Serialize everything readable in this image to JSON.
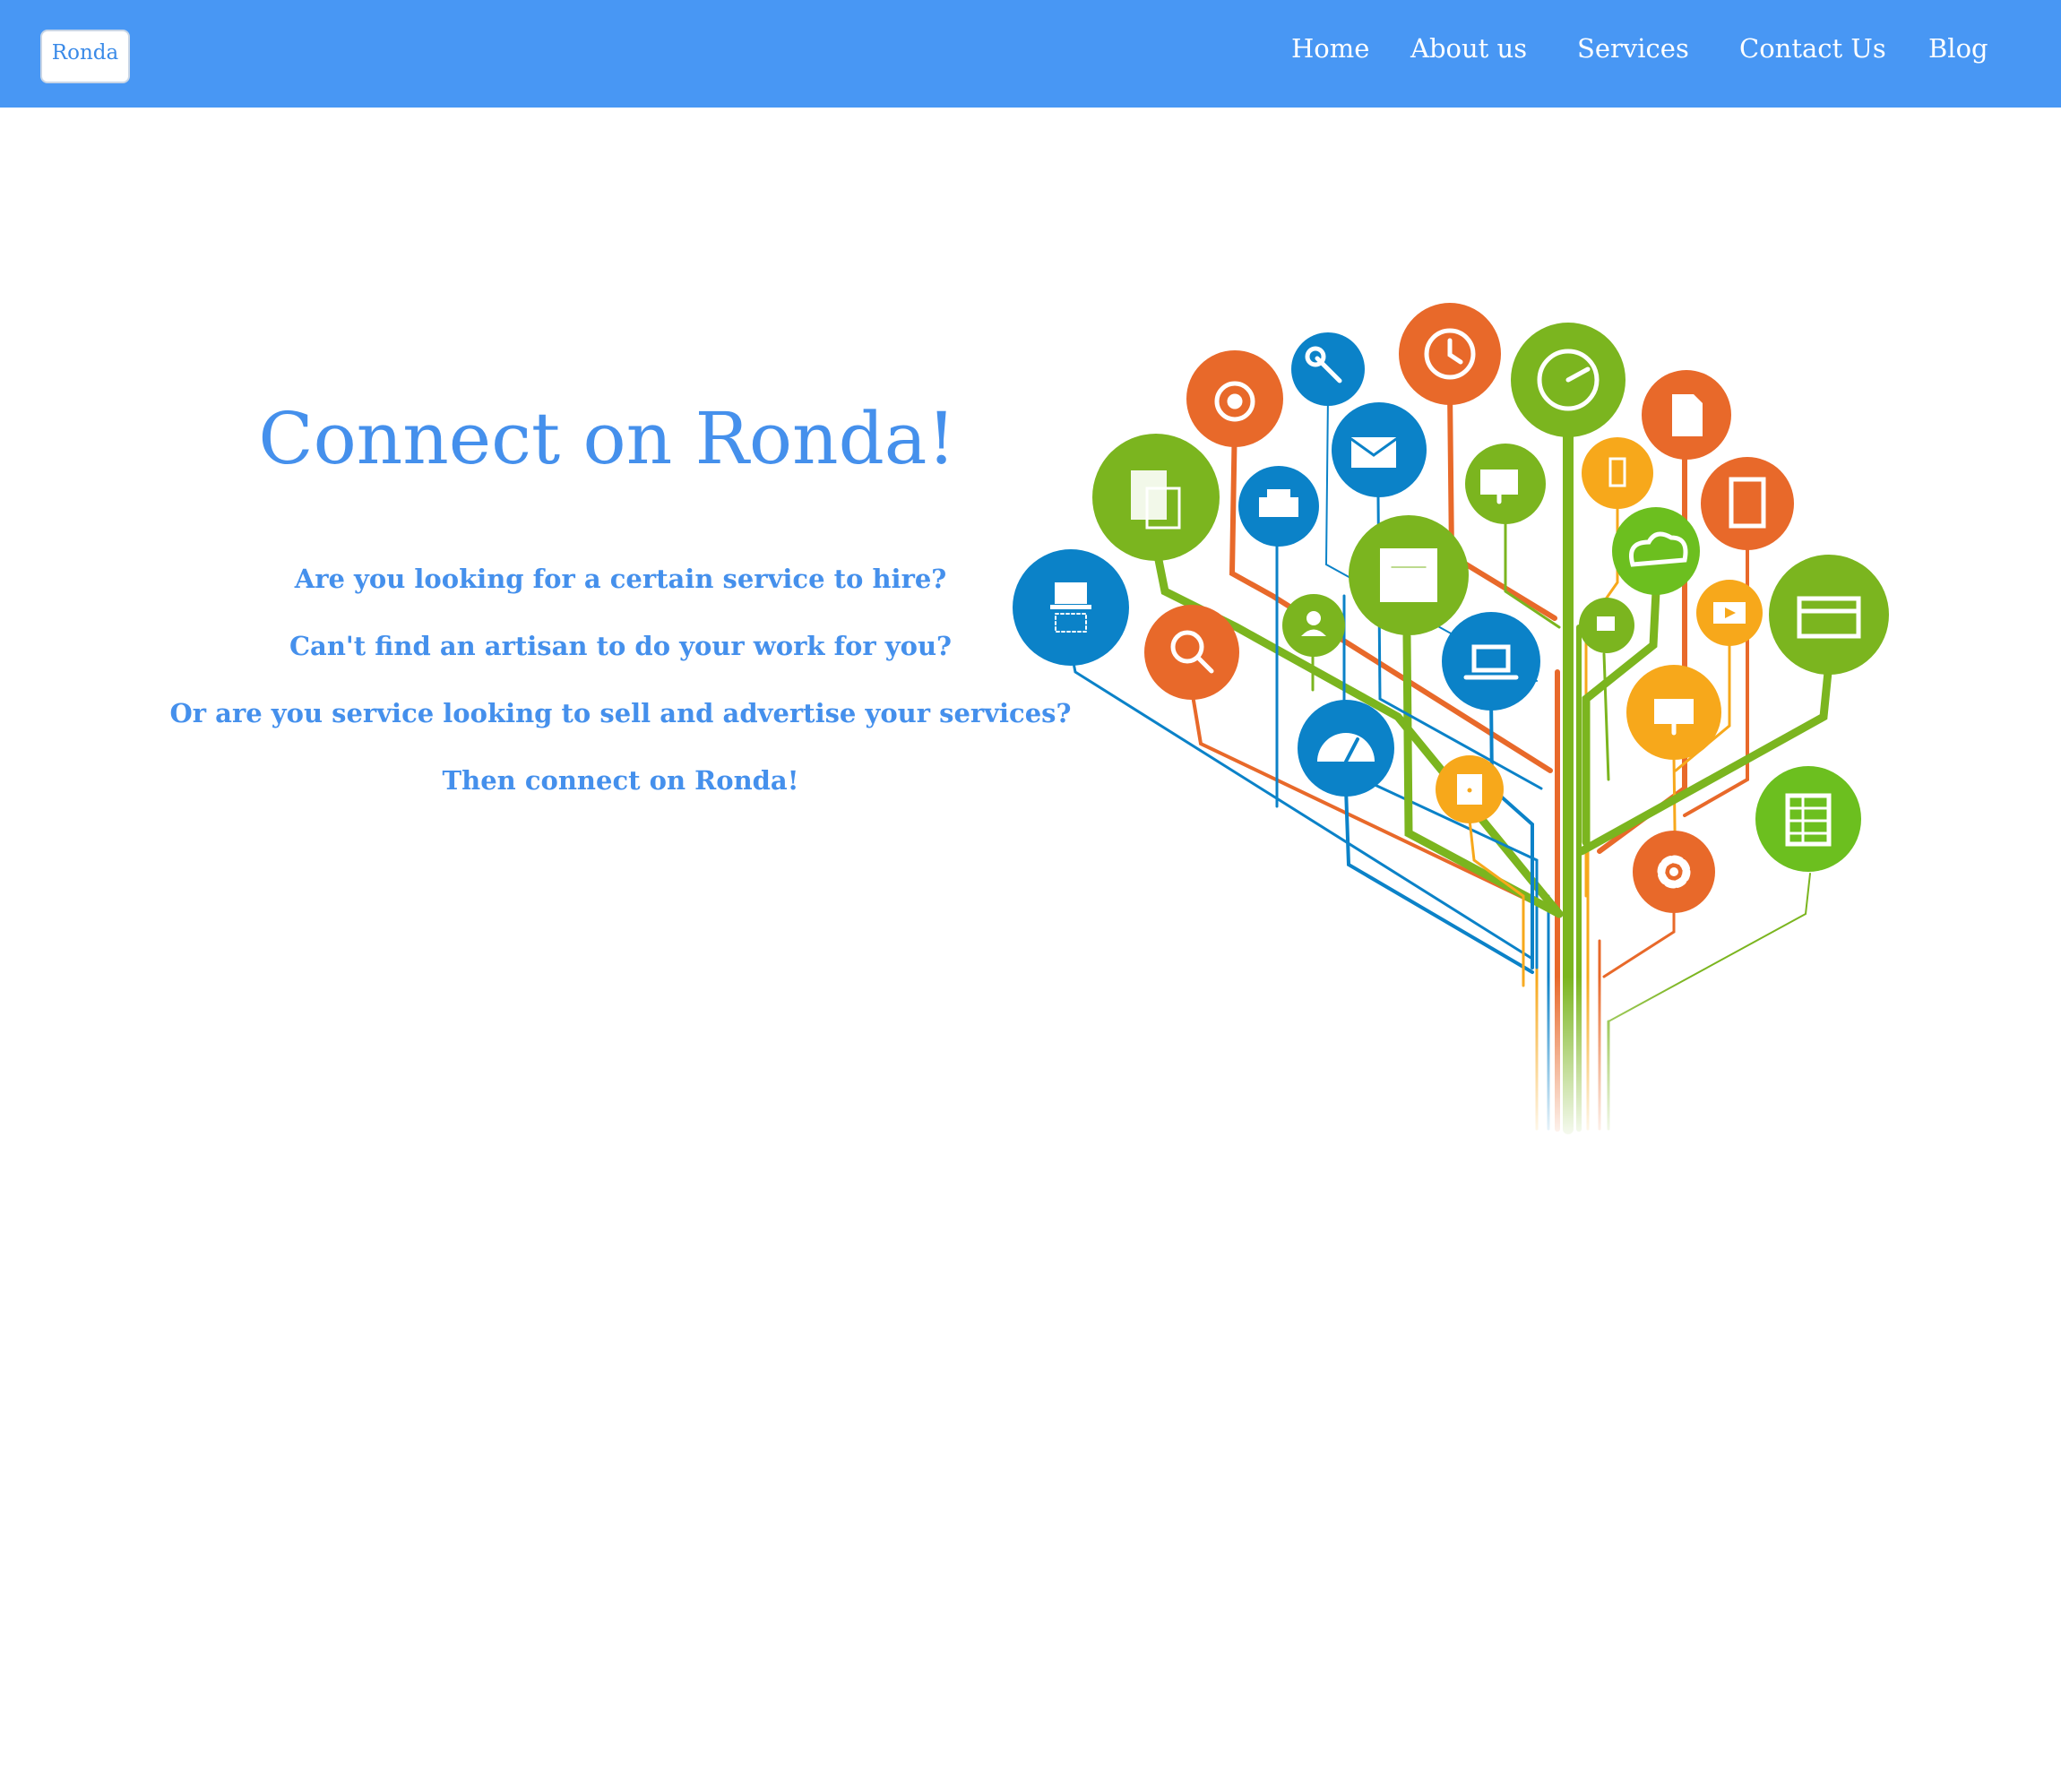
{
  "navbar": {
    "brand": "Ronda",
    "links": [
      "Home",
      "About us",
      "Services",
      "Contact Us",
      "Blog"
    ],
    "background_color": "#4897f4"
  },
  "hero": {
    "title": "Connect on Ronda!",
    "lines": [
      "Are you looking for a certain service to hire?",
      "Can't find an artisan to do your work for you?",
      "Or are you service looking to sell and advertise your services?",
      "Then connect on Ronda!"
    ],
    "text_color": "#4590ec"
  },
  "illustration": {
    "description_icons": [
      "document-icon",
      "printer-icon",
      "wrench-icon",
      "clock-icon",
      "gauge-icon",
      "file-icon",
      "tablet-icon",
      "cloud-icon",
      "www-icon",
      "monitor-icon",
      "gear-icon",
      "spreadsheet-icon",
      "search-icon",
      "user-icon",
      "laptop-icon",
      "email-icon",
      "phone-icon",
      "video-icon",
      "speedometer-icon",
      "fax-icon"
    ],
    "colors": {
      "orange": "#e8692a",
      "green": "#7bb51f",
      "blue": "#0b82c8",
      "yellow": "#f7a81b",
      "bright_green": "#6cbf1f"
    }
  }
}
